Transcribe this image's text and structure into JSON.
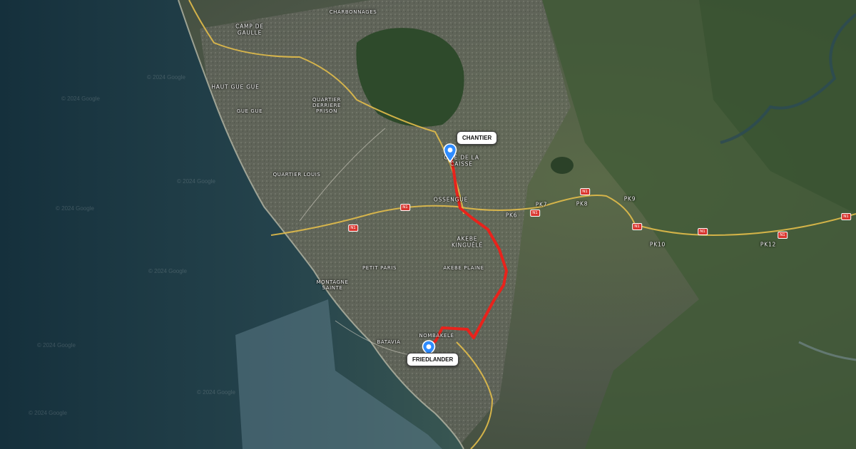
{
  "markers": [
    {
      "name": "CHANTIER",
      "icon": "map-pin-icon",
      "color": "#2f8cff"
    },
    {
      "name": "FRIEDLANDER",
      "icon": "map-pin-icon",
      "color": "#2f8cff"
    }
  ],
  "route": {
    "color": "#e8231c"
  },
  "places": [
    "CHARBONNAGES",
    "CAMP DE GAULLE",
    "HAUT GUE GUE",
    "GUE GUE",
    "QUARTIER DERRIERE PRISON",
    "QUARTIER LOUIS",
    "CITÉ DE LA CAISSE",
    "OSSENGUE",
    "PK6",
    "PK7",
    "PK8",
    "PK9",
    "PK10",
    "PK12",
    "AKEBE KINGUÉLÉ",
    "AKEBE PLAINE",
    "PETIT PARIS",
    "MONTAGNE SAINTE",
    "NOMBAKELÉ",
    "BATAVIA"
  ],
  "road_shield": "N1",
  "credit": "© 2024 Google"
}
